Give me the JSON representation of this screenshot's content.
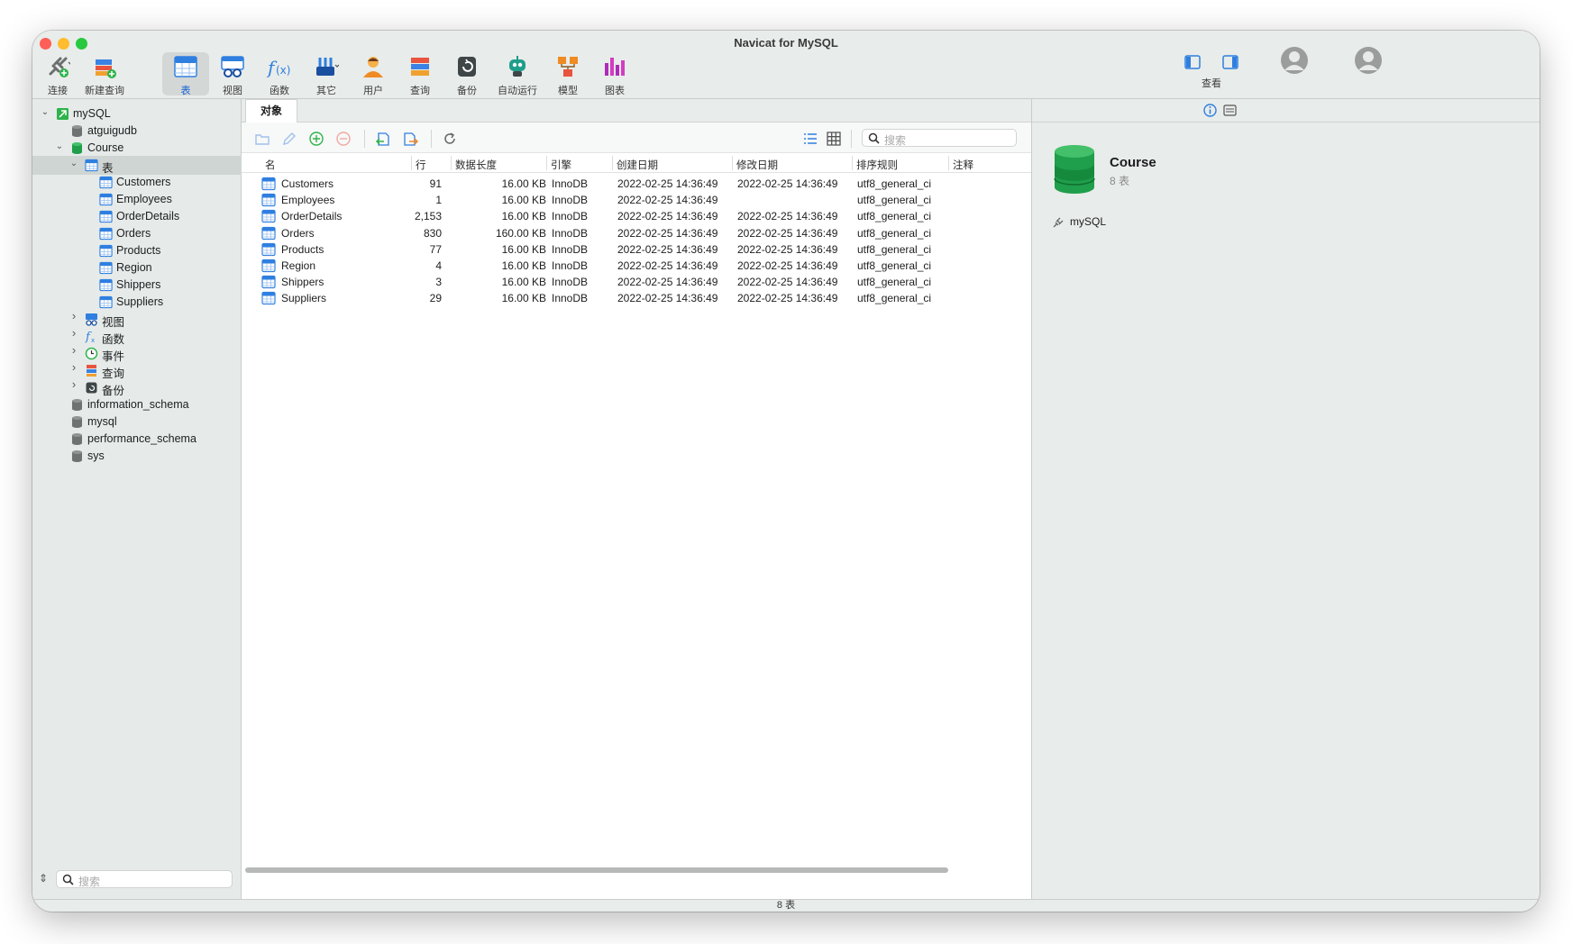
{
  "window": {
    "title": "Navicat for MySQL"
  },
  "toolbar": {
    "items": [
      {
        "label": "连接",
        "icon": "connect-plug-icon"
      },
      {
        "label": "新建查询",
        "icon": "new-query-icon"
      },
      {
        "label": "表",
        "icon": "table-icon",
        "active": true
      },
      {
        "label": "视图",
        "icon": "view-icon"
      },
      {
        "label": "函数",
        "icon": "function-icon"
      },
      {
        "label": "其它",
        "icon": "other-tools-icon"
      },
      {
        "label": "用户",
        "icon": "user-icon"
      },
      {
        "label": "查询",
        "icon": "query-icon"
      },
      {
        "label": "备份",
        "icon": "backup-icon"
      },
      {
        "label": "自动运行",
        "icon": "automation-robot-icon"
      },
      {
        "label": "模型",
        "icon": "model-icon"
      },
      {
        "label": "图表",
        "icon": "chart-icon"
      }
    ],
    "view_label": "查看"
  },
  "sidebar": {
    "connection": "mySQL",
    "databases_top": [
      "atguigudb"
    ],
    "open_db": "Course",
    "tables_node": "表",
    "tables": [
      "Customers",
      "Employees",
      "OrderDetails",
      "Orders",
      "Products",
      "Region",
      "Shippers",
      "Suppliers"
    ],
    "groups": [
      {
        "label": "视图",
        "icon": "view-icon"
      },
      {
        "label": "函数",
        "icon": "function-icon"
      },
      {
        "label": "事件",
        "icon": "event-clock-icon"
      },
      {
        "label": "查询",
        "icon": "query-icon"
      },
      {
        "label": "备份",
        "icon": "backup-icon"
      }
    ],
    "databases_bottom": [
      "information_schema",
      "mysql",
      "performance_schema",
      "sys"
    ],
    "search_placeholder": "搜索"
  },
  "main": {
    "tab": "对象",
    "search_placeholder": "搜索",
    "columns": [
      "名",
      "行",
      "数据长度",
      "引擎",
      "创建日期",
      "修改日期",
      "排序规则",
      "注释"
    ],
    "rows": [
      {
        "name": "Customers",
        "rows": "91",
        "size": "16.00 KB",
        "engine": "InnoDB",
        "created": "2022-02-25 14:36:49",
        "modified": "2022-02-25 14:36:49",
        "collation": "utf8_general_ci",
        "comment": ""
      },
      {
        "name": "Employees",
        "rows": "1",
        "size": "16.00 KB",
        "engine": "InnoDB",
        "created": "2022-02-25 14:36:49",
        "modified": "",
        "collation": "utf8_general_ci",
        "comment": ""
      },
      {
        "name": "OrderDetails",
        "rows": "2,153",
        "size": "16.00 KB",
        "engine": "InnoDB",
        "created": "2022-02-25 14:36:49",
        "modified": "2022-02-25 14:36:49",
        "collation": "utf8_general_ci",
        "comment": ""
      },
      {
        "name": "Orders",
        "rows": "830",
        "size": "160.00 KB",
        "engine": "InnoDB",
        "created": "2022-02-25 14:36:49",
        "modified": "2022-02-25 14:36:49",
        "collation": "utf8_general_ci",
        "comment": ""
      },
      {
        "name": "Products",
        "rows": "77",
        "size": "16.00 KB",
        "engine": "InnoDB",
        "created": "2022-02-25 14:36:49",
        "modified": "2022-02-25 14:36:49",
        "collation": "utf8_general_ci",
        "comment": ""
      },
      {
        "name": "Region",
        "rows": "4",
        "size": "16.00 KB",
        "engine": "InnoDB",
        "created": "2022-02-25 14:36:49",
        "modified": "2022-02-25 14:36:49",
        "collation": "utf8_general_ci",
        "comment": ""
      },
      {
        "name": "Shippers",
        "rows": "3",
        "size": "16.00 KB",
        "engine": "InnoDB",
        "created": "2022-02-25 14:36:49",
        "modified": "2022-02-25 14:36:49",
        "collation": "utf8_general_ci",
        "comment": ""
      },
      {
        "name": "Suppliers",
        "rows": "29",
        "size": "16.00 KB",
        "engine": "InnoDB",
        "created": "2022-02-25 14:36:49",
        "modified": "2022-02-25 14:36:49",
        "collation": "utf8_general_ci",
        "comment": ""
      }
    ]
  },
  "info_panel": {
    "name": "Course",
    "subtitle": "8 表",
    "connection": "mySQL"
  },
  "status": {
    "text": "8 表"
  },
  "colors": {
    "accent": "#1663d6",
    "db_green": "#1f9e4b",
    "table_blue": "#2f7fe0"
  }
}
